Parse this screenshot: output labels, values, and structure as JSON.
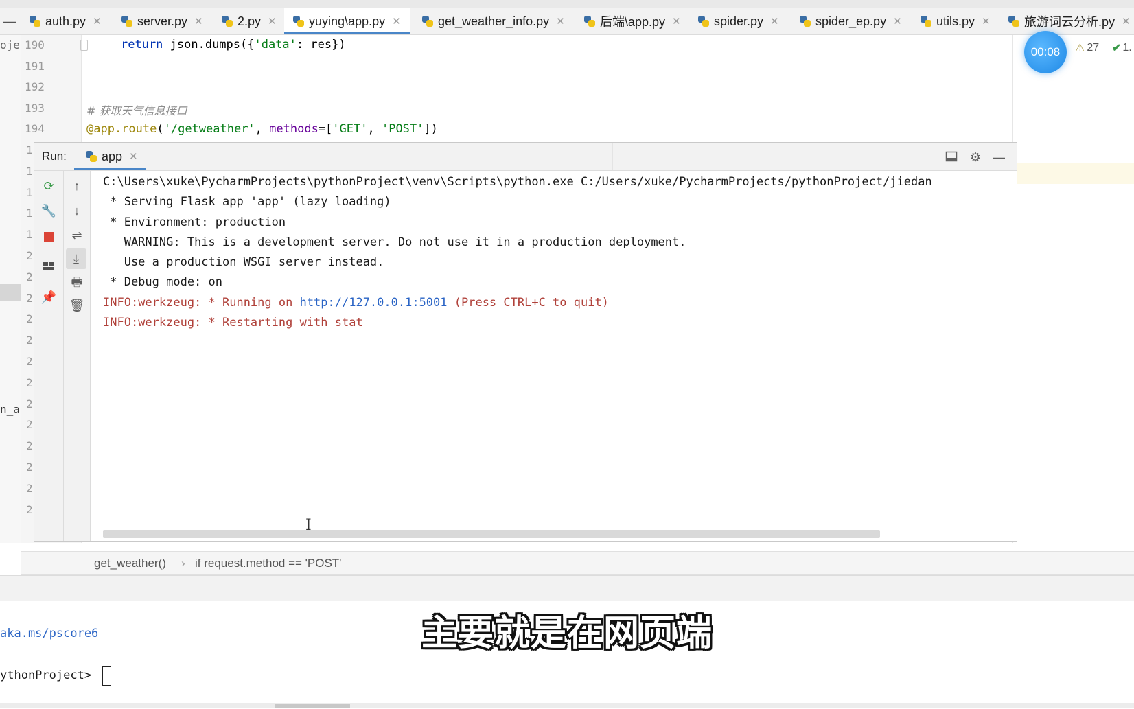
{
  "tabs": [
    {
      "label": "auth.py",
      "active": false
    },
    {
      "label": "server.py",
      "active": false
    },
    {
      "label": "2.py",
      "active": false
    },
    {
      "label": "yuying\\app.py",
      "active": true
    },
    {
      "label": "get_weather_info.py",
      "active": false
    },
    {
      "label": "后端\\app.py",
      "active": false
    },
    {
      "label": "spider.py",
      "active": false
    },
    {
      "label": "spider_ep.py",
      "active": false
    },
    {
      "label": "utils.py",
      "active": false
    },
    {
      "label": "旅游词云分析.py",
      "active": false
    }
  ],
  "editor": {
    "line_numbers": [
      "190",
      "191",
      "192",
      "193",
      "194"
    ],
    "line190": {
      "keyword": "return",
      "rest1": " json.dumps({",
      "str": "'data'",
      "rest2": ": res})"
    },
    "line193": {
      "comment": "# 获取天气信息接口"
    },
    "line194": {
      "decorator": "@app.route",
      "open": "(",
      "route": "'/getweather'",
      "sep": ", ",
      "param": "methods",
      "eq": "=[",
      "get": "'GET'",
      "comma": ", ",
      "post": "'POST'",
      "close": "])"
    },
    "gutter_fragments": [
      "oje",
      "n_a"
    ],
    "side_digits": [
      "1",
      "1",
      "1",
      "1",
      "1",
      "2",
      "2",
      "2",
      "2",
      "2",
      "2",
      "2",
      "2",
      "2",
      "2",
      "2",
      "2",
      "2"
    ]
  },
  "status": {
    "timer": "00:08",
    "warnings": "27",
    "checks": "1."
  },
  "run": {
    "label": "Run:",
    "tab_label": "app",
    "lines": [
      "C:\\Users\\xuke\\PycharmProjects\\pythonProject\\venv\\Scripts\\python.exe C:/Users/xuke/PycharmProjects/pythonProject/jiedan",
      " * Serving Flask app 'app' (lazy loading)",
      " * Environment: production",
      "   WARNING: This is a development server. Do not use it in a production deployment.",
      "   Use a production WSGI server instead.",
      " * Debug mode: on"
    ],
    "info1_prefix": "INFO:werkzeug: * Running on ",
    "info1_link": "http://127.0.0.1:5001",
    "info1_suffix": " (Press CTRL+C to quit)",
    "info2": "INFO:werkzeug: * Restarting with stat"
  },
  "breadcrumb": {
    "function": "get_weather()",
    "separator": "›",
    "condition": "if request.method == 'POST'"
  },
  "terminal": {
    "link": "aka.ms/pscore6",
    "prompt": "ythonProject>"
  },
  "subtitle": "主要就是在网页端"
}
